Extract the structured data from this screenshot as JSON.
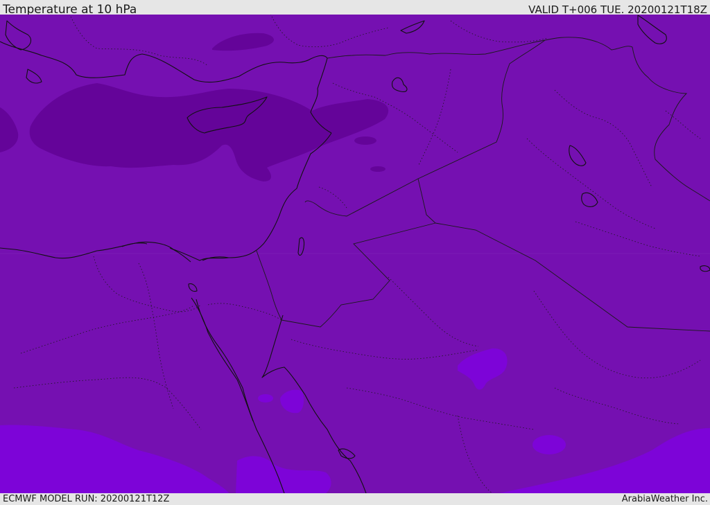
{
  "header": {
    "title": "Temperature at 10 hPa",
    "valid": "VALID T+006 TUE. 20200121T18Z"
  },
  "footer": {
    "model_run": "ECMWF MODEL RUN: 20200121T12Z",
    "brand": "ArabiaWeather Inc."
  },
  "colors": {
    "base": "#7510b1",
    "cold": "#640499",
    "warm": "#7d04d8",
    "coast": "#111111",
    "border": "#1a1a1a"
  }
}
